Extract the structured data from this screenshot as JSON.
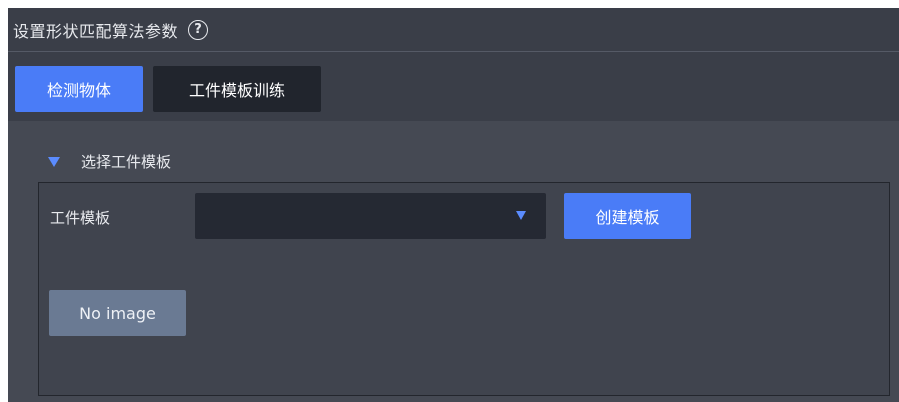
{
  "header": {
    "title": "设置形状匹配算法参数",
    "help_icon": "?"
  },
  "tabs": [
    {
      "label": "检测物体",
      "active": true
    },
    {
      "label": "工件模板训练",
      "active": false
    }
  ],
  "section": {
    "title": "选择工件模板",
    "expanded": true
  },
  "template_field": {
    "label": "工件模板",
    "value": "",
    "create_button_label": "创建模板"
  },
  "preview": {
    "no_image_label": "No image"
  },
  "colors": {
    "accent": "#4a7cf7",
    "panel_bg": "#3a3e48",
    "content_bg": "#454953"
  }
}
